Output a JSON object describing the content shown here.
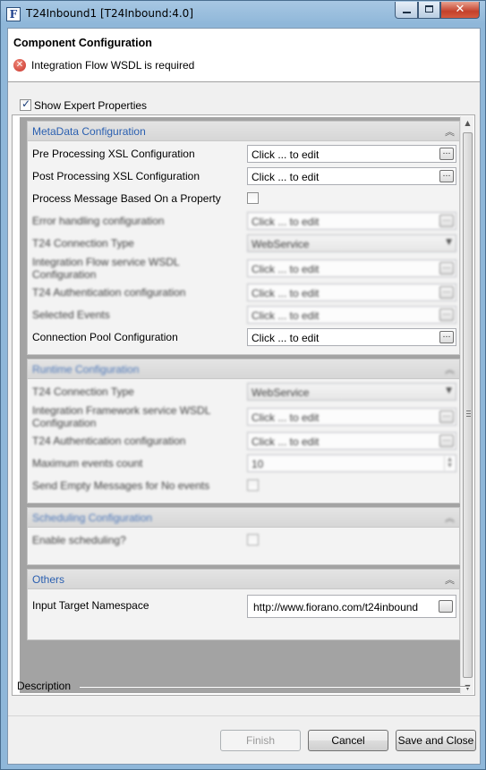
{
  "window": {
    "app_icon_letter": "F",
    "title": "T24Inbound1 [T24Inbound:4.0]"
  },
  "header": {
    "title": "Component Configuration",
    "error_message": "Integration Flow WSDL is required"
  },
  "show_expert": {
    "label": "Show Expert Properties",
    "checked": true
  },
  "sections": {
    "metadata": {
      "title": "MetaData Configuration",
      "rows": {
        "pre_processing": {
          "label": "Pre Processing XSL Configuration",
          "value": "Click ... to edit"
        },
        "post_processing": {
          "label": "Post Processing XSL Configuration",
          "value": "Click ... to edit"
        },
        "process_message": {
          "label": "Process Message Based On a Property"
        },
        "error_handling": {
          "label": "Error handling configuration",
          "value": "Click ... to edit"
        },
        "connection_type": {
          "label": "T24 Connection Type",
          "value": "WebService"
        },
        "flow_wsdl": {
          "label": "Integration Flow service WSDL Configuration",
          "value": "Click ... to edit"
        },
        "auth": {
          "label": "T24 Authentication configuration",
          "value": "Click ... to edit"
        },
        "selected_events": {
          "label": "Selected Events",
          "value": "Click ... to edit"
        },
        "connection_pool": {
          "label": "Connection Pool Configuration",
          "value": "Click ... to edit"
        }
      }
    },
    "runtime": {
      "title": "Runtime Configuration",
      "rows": {
        "connection_type": {
          "label": "T24 Connection Type",
          "value": "WebService"
        },
        "framework_wsdl": {
          "label": "Integration Framework service WSDL Configuration",
          "value": "Click ... to edit"
        },
        "auth": {
          "label": "T24 Authentication configuration",
          "value": "Click ... to edit"
        },
        "max_events": {
          "label": "Maximum events count",
          "value": "10"
        },
        "send_empty": {
          "label": "Send Empty Messages for No events"
        }
      }
    },
    "scheduling": {
      "title": "Scheduling Configuration",
      "rows": {
        "enable": {
          "label": "Enable scheduling?"
        }
      }
    },
    "others": {
      "title": "Others",
      "rows": {
        "namespace": {
          "label": "Input Target Namespace",
          "value": "http://www.fiorano.com/t24inbound"
        }
      }
    }
  },
  "description": {
    "label": "Description"
  },
  "buttons": {
    "finish": "Finish",
    "cancel": "Cancel",
    "save_close": "Save and Close"
  },
  "icons": {
    "error": "error-icon",
    "collapse": "double-chevron-up-icon",
    "ellipsis": "ellipsis-icon",
    "dropdown": "chevron-down-icon"
  }
}
